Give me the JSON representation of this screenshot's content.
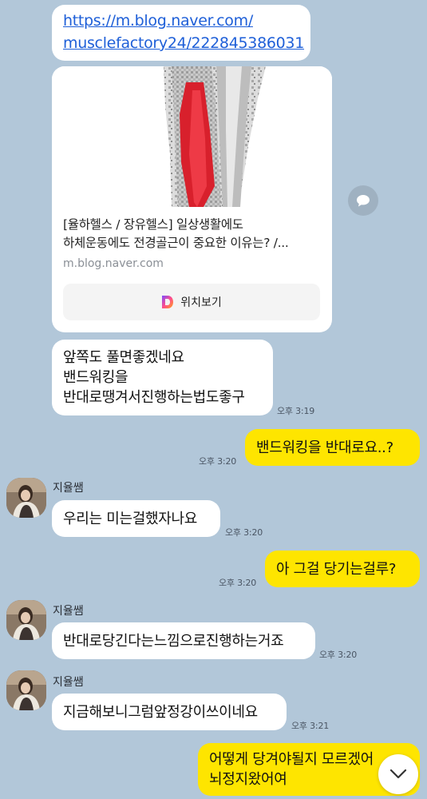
{
  "link_message": {
    "line1": "https://m.blog.naver.com/",
    "line2": "musclefactory24/222845386031"
  },
  "preview": {
    "title_line1": "[율하헬스 / 장유헬스] 일상생활에도",
    "title_line2": "하체운동에도 전경골근이 중요한 이유는? /...",
    "domain": "m.blog.naver.com",
    "button_label": "위치보기",
    "button_icon": "naver-d-icon",
    "share_icon": "speech-bubble-icon"
  },
  "messages": [
    {
      "side": "left",
      "lines": [
        "앞쪽도 풀면좋겠네요",
        "밴드워킹을",
        "반대로땡겨서진행하는법도좋구"
      ],
      "time": "오후 3:19"
    },
    {
      "side": "right",
      "lines": [
        "밴드워킹을 반대로요..?"
      ],
      "time": "오후 3:20"
    },
    {
      "side": "left",
      "sender": "지율쌤",
      "lines": [
        "우리는 미는걸했자나요"
      ],
      "time": "오후 3:20"
    },
    {
      "side": "right",
      "lines": [
        "아 그걸 당기는걸루?"
      ],
      "time": "오후 3:20"
    },
    {
      "side": "left",
      "sender": "지율쌤",
      "lines": [
        "반대로당긴다는느낌으로진행하는거죠"
      ],
      "time": "오후 3:20"
    },
    {
      "side": "left",
      "sender": "지율쌤",
      "lines": [
        "지금해보니그럼앞정강이쓰이네요"
      ],
      "time": "오후 3:21"
    },
    {
      "side": "right",
      "lines": [
        "어떻게 당겨야될지 모르겠어",
        "뇌정지왔어여"
      ]
    }
  ],
  "scroll_icon": "chevron-down-icon",
  "colors": {
    "background": "#b2c7d9",
    "my_bubble": "#fee500",
    "their_bubble": "#ffffff",
    "link": "#1e5fd8"
  }
}
